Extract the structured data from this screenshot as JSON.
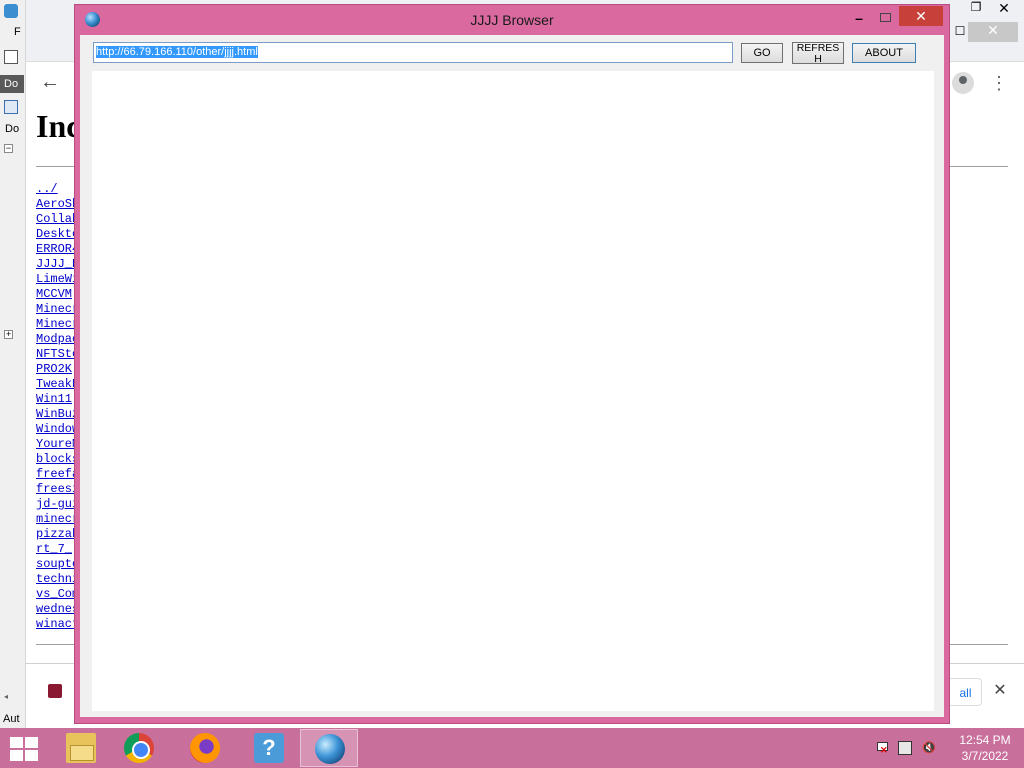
{
  "background_left_app": {
    "menu_letter": "F",
    "doc_tab": "Do",
    "doc_label": "Do",
    "bottom_label": "Aut"
  },
  "background_browser": {
    "page_heading": "Inc",
    "files": [
      "../",
      "AeroSh",
      "Collab",
      "Deskto",
      "ERROR4",
      "JJJJ_B",
      "LimeWi",
      "MCCVM",
      "Minecr",
      "Minecr",
      "Modpac",
      "NFTSto",
      "PRO2K",
      "TweakN",
      "Win11",
      "WinBuz",
      "Window",
      "YoureM",
      "blocks",
      "freefa",
      "freesi",
      "jd-gui",
      "minecr",
      "pizzab",
      "rt_7_",
      "soupto",
      "techni",
      "vs_Com",
      "wednes",
      "winact"
    ],
    "show_all_label": "all"
  },
  "jjjj_browser": {
    "title": "JJJJ Browser",
    "url": "http://66.79.166.110/other/jjjj.html",
    "go_label": "GO",
    "refresh_label": "REFRESH",
    "about_label": "ABOUT"
  },
  "taskbar": {
    "apps": [
      "file-explorer",
      "chrome",
      "firefox",
      "help",
      "jjjj-browser"
    ],
    "help_glyph": "?",
    "clock_time": "12:54 PM",
    "clock_date": "3/7/2022"
  },
  "colors": {
    "window_frame": "#d9699f",
    "taskbar": "#c86f9b",
    "close_button": "#c7403a",
    "selection": "#3399ff"
  }
}
